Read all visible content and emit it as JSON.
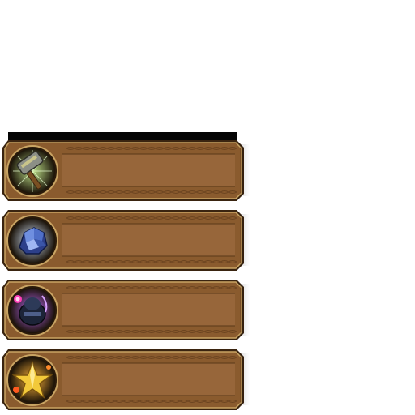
{
  "equipment_slots": [
    {
      "id": "slot-1",
      "icon": "war-hammer-icon",
      "label": "",
      "glow_color": "#bfe28a"
    },
    {
      "id": "slot-2",
      "icon": "blue-ore-crystal-icon",
      "label": "",
      "glow_color": "#d7e8ff"
    },
    {
      "id": "slot-3",
      "icon": "dark-armor-orb-icon",
      "label": "",
      "glow_color": "#c26bff"
    },
    {
      "id": "slot-4",
      "icon": "gold-star-icon",
      "label": "",
      "glow_color": "#ffb43a"
    }
  ],
  "colors": {
    "frame_outer": "#3a2410",
    "frame_border": "#c9a463",
    "panel_fill": "#8a5b2e",
    "panel_inner": "#97663a",
    "braid": "#6b4420"
  }
}
